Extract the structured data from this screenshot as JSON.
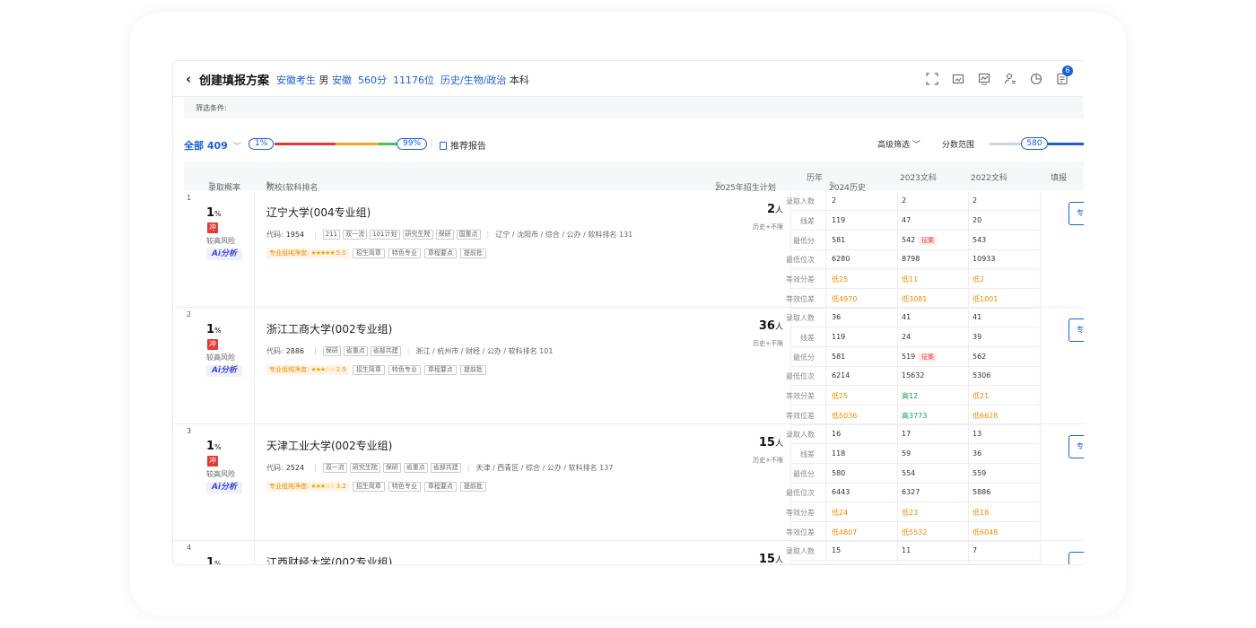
{
  "header": {
    "back_icon": "‹",
    "title": "创建填报方案",
    "province_candidate": "安徽考生",
    "gender": "男",
    "province": "安徽",
    "score": "560分",
    "rank": "11176位",
    "subjects": "历史/生物/政治",
    "level": "本科",
    "notification_count": "6"
  },
  "filter": {
    "label": "筛选条件:"
  },
  "controls": {
    "all_label": "全部 409",
    "chevron": "﹀",
    "pct_min": "1%",
    "pct_max": "99%",
    "report_label": "推荐报告",
    "advanced_label": "高级筛选",
    "advanced_chevron": "﹀",
    "score_range_label": "分数范围",
    "score_range_value": "580"
  },
  "table_header": {
    "prob": "录取概率",
    "school": "院校(软科排名",
    "school_sort": "⇅",
    "school_close": ")",
    "school_chev": "﹀",
    "plan": "2025年招生计划",
    "plan_sort": "⇅",
    "years": "历年",
    "y2024": "2024历史",
    "y2024_sort": "⇅",
    "y2023": "2023文科",
    "y2022": "2022文科",
    "fill": "填报",
    "prob_sort": "⇅"
  },
  "hist_labels": [
    "录取人数",
    "线差",
    "最低分",
    "最低位次",
    "等效分差",
    "等效位差"
  ],
  "rows": [
    {
      "num": "1",
      "prob": "1",
      "prob_unit": "%",
      "chong": "冲",
      "risk": "较高风险",
      "ai": "Ai分析",
      "name": "辽宁大学(004专业组)",
      "code_label": "代码:",
      "code": "1954",
      "tags": [
        "211",
        "双一流",
        "101计划",
        "研究生院",
        "保研",
        "国重点"
      ],
      "location": "辽宁 / 沈阳市 / 综合 / 公办 / 软科排名 131",
      "purity_label": "专业组纯净度:",
      "stars": "★★★★★",
      "purity": "5.0",
      "extra_tags": [
        "招生简章",
        "特色专业",
        "章程要点",
        "提前批"
      ],
      "plan": "2",
      "plan_unit": "人",
      "plan_limit": "历史+不限",
      "hist": [
        [
          "2",
          "2",
          "2"
        ],
        [
          "119",
          "47",
          "20"
        ],
        [
          "581",
          "542",
          "543"
        ],
        [
          "6280",
          "8798",
          "10933"
        ],
        [
          "低25",
          "低11",
          "低2"
        ],
        [
          "低4970",
          "低3081",
          "低1001"
        ]
      ],
      "zheng": "征集",
      "fill_label": "专"
    },
    {
      "num": "2",
      "prob": "1",
      "prob_unit": "%",
      "chong": "冲",
      "risk": "较高风险",
      "ai": "Ai分析",
      "name": "浙江工商大学(002专业组)",
      "code_label": "代码:",
      "code": "2886",
      "tags": [
        "保研",
        "省重点",
        "省部共建"
      ],
      "location": "浙江 / 杭州市 / 财经 / 公办 / 软科排名 101",
      "purity_label": "专业组纯净度:",
      "stars": "★★★☆☆",
      "purity": "2.9",
      "extra_tags": [
        "招生简章",
        "特色专业",
        "章程要点",
        "提前批"
      ],
      "plan": "36",
      "plan_unit": "人",
      "plan_limit": "历史+不限",
      "hist": [
        [
          "36",
          "41",
          "41"
        ],
        [
          "119",
          "24",
          "39"
        ],
        [
          "581",
          "519",
          "562"
        ],
        [
          "6214",
          "15632",
          "5306"
        ],
        [
          "低25",
          "高12",
          "低21"
        ],
        [
          "低5036",
          "高3773",
          "低6628"
        ]
      ],
      "zheng": "征集",
      "fill_label": "专"
    },
    {
      "num": "3",
      "prob": "1",
      "prob_unit": "%",
      "chong": "冲",
      "risk": "较高风险",
      "ai": "Ai分析",
      "name": "天津工业大学(002专业组)",
      "code_label": "代码:",
      "code": "2524",
      "tags": [
        "双一流",
        "研究生院",
        "保研",
        "省重点",
        "省部共建"
      ],
      "location": "天津 / 西青区 / 综合 / 公办 / 软科排名 137",
      "purity_label": "专业组纯净度:",
      "stars": "★★★☆☆",
      "purity": "3.2",
      "extra_tags": [
        "招生简章",
        "特色专业",
        "章程要点",
        "提前批"
      ],
      "plan": "15",
      "plan_unit": "人",
      "plan_limit": "历史+不限",
      "hist": [
        [
          "16",
          "17",
          "13"
        ],
        [
          "118",
          "59",
          "36"
        ],
        [
          "580",
          "554",
          "559"
        ],
        [
          "6443",
          "6327",
          "5886"
        ],
        [
          "低24",
          "低23",
          "低18"
        ],
        [
          "低4807",
          "低5532",
          "低6048"
        ]
      ],
      "fill_label": "专"
    },
    {
      "num": "4",
      "prob": "1",
      "prob_unit": "%",
      "name": "江西财经大学(002专业组)",
      "plan": "15",
      "plan_unit": "人",
      "hist": [
        [
          "15",
          "11",
          "7"
        ]
      ]
    }
  ],
  "colors": {
    "accent": "#1a5fd8",
    "danger": "#e53935",
    "warn": "#f08c00",
    "good": "#16a34a"
  }
}
